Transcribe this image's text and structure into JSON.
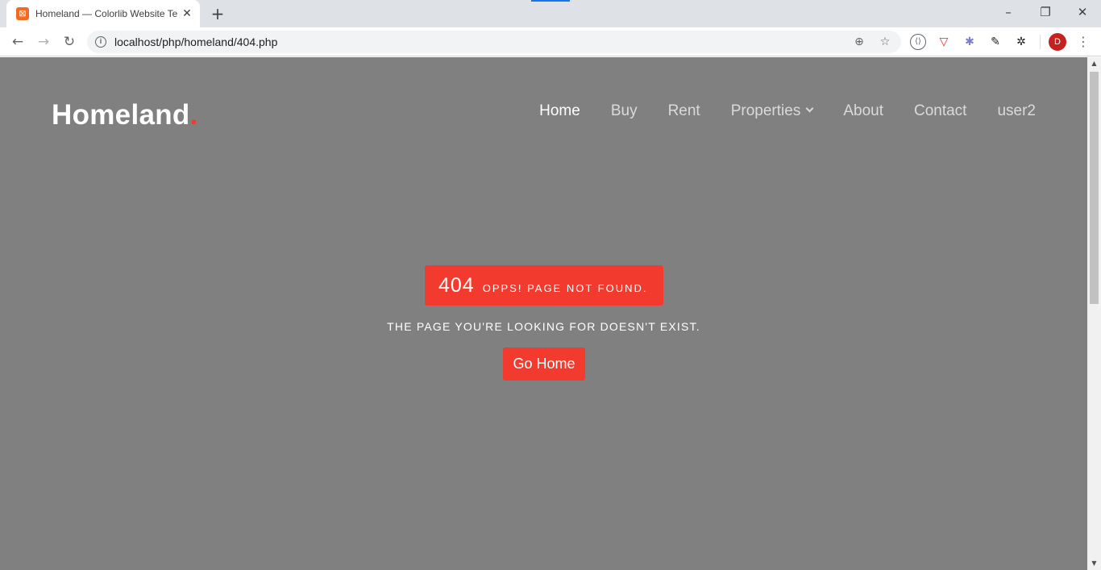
{
  "browser": {
    "tab_title": "Homeland — Colorlib Website Te",
    "url": "localhost/php/homeland/404.php",
    "profile_initial": "D"
  },
  "site": {
    "logo_text": "Homeland",
    "logo_dot": ".",
    "nav": [
      {
        "label": "Home",
        "active": true
      },
      {
        "label": "Buy"
      },
      {
        "label": "Rent"
      },
      {
        "label": "Properties",
        "has_dropdown": true
      },
      {
        "label": "About"
      },
      {
        "label": "Contact"
      },
      {
        "label": "user2"
      }
    ]
  },
  "error": {
    "code": "404",
    "message": "OPPS! PAGE NOT FOUND.",
    "subtitle": "THE PAGE YOU'RE LOOKING FOR DOESN'T EXIST.",
    "button_label": "Go Home"
  },
  "colors": {
    "accent": "#f23a2e",
    "overlay": "#808080"
  }
}
